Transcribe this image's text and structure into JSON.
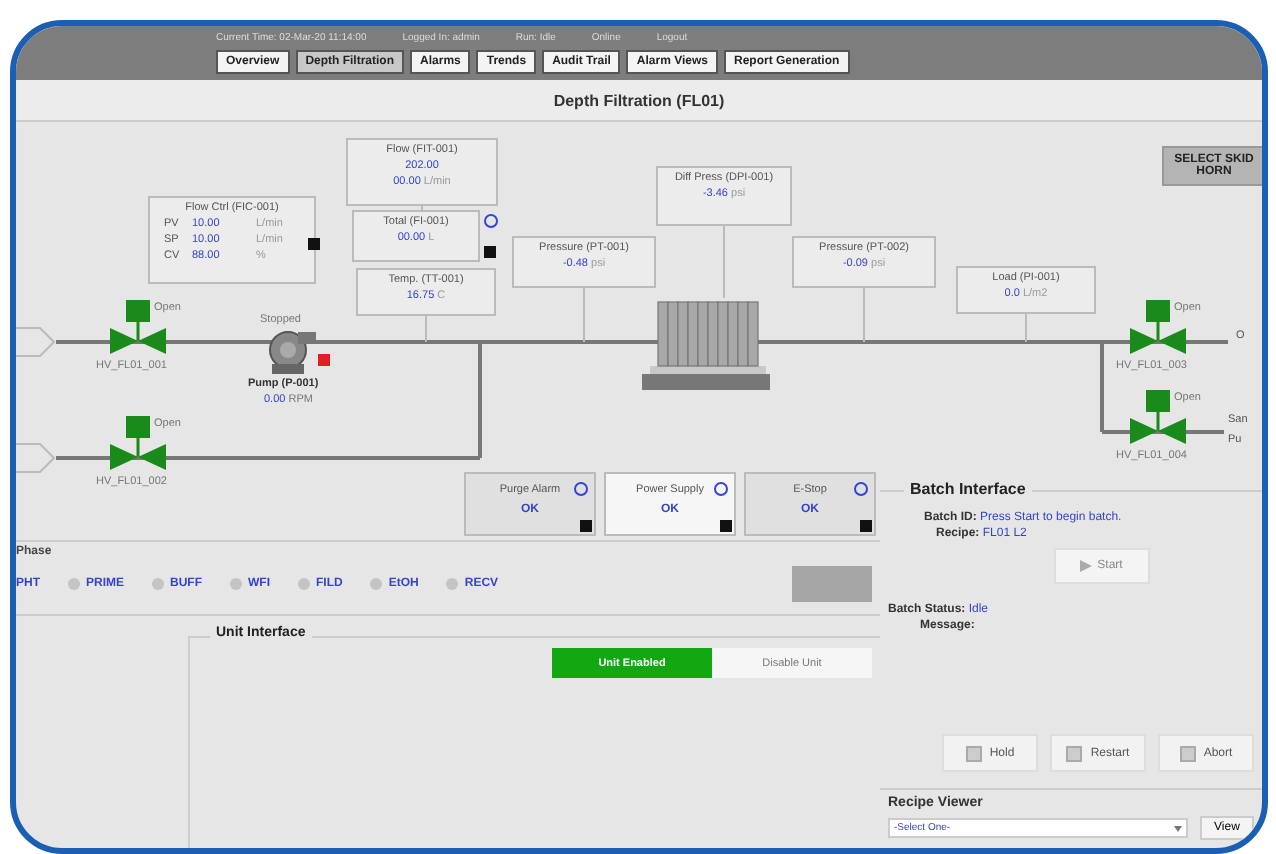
{
  "header": {
    "info": [
      "Current Time: 02-Mar-20 11:14:00",
      "Logged In: admin",
      "Run: Idle",
      "Online",
      "Logout"
    ],
    "nav": [
      {
        "label": "Overview",
        "selected": false
      },
      {
        "label": "Depth Filtration",
        "selected": true
      },
      {
        "label": "Alarms",
        "selected": false
      },
      {
        "label": "Trends",
        "selected": false
      },
      {
        "label": "Audit Trail",
        "selected": false
      },
      {
        "label": "Alarm Views",
        "selected": false
      },
      {
        "label": "Report Generation",
        "selected": false
      }
    ]
  },
  "title": "Depth Filtration (FL01)",
  "horn_button": "SELECT SKID HORN",
  "instruments": [
    {
      "kind": "table",
      "title": "Flow Ctrl (FIC-001)",
      "rows": [
        {
          "tag": "PV",
          "value": "10.00",
          "unit": "L/min"
        },
        {
          "tag": "SP",
          "value": "10.00",
          "unit": "L/min"
        },
        {
          "tag": "CV",
          "value": "88.00",
          "unit": "%"
        }
      ]
    },
    {
      "kind": "readout",
      "title": "Flow (FIT-001)",
      "lines": [
        {
          "value": "202.00"
        },
        {
          "value": "00.00",
          "unit": "L/min"
        }
      ]
    },
    {
      "kind": "readout",
      "title": "Total (FI-001)",
      "lines": [
        {
          "value": "00.00",
          "unit": "L"
        }
      ]
    },
    {
      "kind": "readout",
      "title": "Temp. (TT-001)",
      "lines": [
        {
          "value": "16.75",
          "unit": "C"
        }
      ]
    },
    {
      "kind": "readout",
      "title": "Pressure (PT-001)",
      "lines": [
        {
          "value": "-0.48",
          "unit": "psi"
        }
      ]
    },
    {
      "kind": "readout",
      "title": "Diff Press (DPI-001)",
      "lines": [
        {
          "value": "-3.46",
          "unit": "psi"
        }
      ]
    },
    {
      "kind": "readout",
      "title": "Pressure (PT-002)",
      "lines": [
        {
          "value": "-0.09",
          "unit": "psi"
        }
      ]
    },
    {
      "kind": "readout",
      "title": "Load (PI-001)",
      "lines": [
        {
          "value": "0.0",
          "unit": "L/m2"
        }
      ]
    }
  ],
  "valves": [
    {
      "tag": "HV_FL01_001",
      "status": "Open",
      "open": true
    },
    {
      "tag": "HV_FL01_002",
      "status": "Open",
      "open": true
    },
    {
      "tag": "HV_FL01_003",
      "status": "Open",
      "open": true
    },
    {
      "tag": "HV_FL01_004",
      "status": "Open",
      "open": true
    }
  ],
  "pump": {
    "status": "Stopped",
    "name": "Pump (P-001)",
    "value": "0.00",
    "unit": "RPM",
    "fault": true
  },
  "outlets": [
    "O",
    "San",
    "Pu"
  ],
  "status_boxes": [
    {
      "label": "Purge Alarm",
      "value": "OK",
      "highlighted": false
    },
    {
      "label": "Power Supply",
      "value": "OK",
      "highlighted": true
    },
    {
      "label": "E-Stop",
      "value": "OK",
      "highlighted": false
    }
  ],
  "phase": {
    "label": "Phase",
    "items": [
      "PHT",
      "PRIME",
      "BUFF",
      "WFI",
      "FILD",
      "EtOH",
      "RECV"
    ]
  },
  "unit_interface": {
    "title": "Unit Interface",
    "buttons": [
      {
        "label": "Unit Enabled",
        "selected": true
      },
      {
        "label": "Disable Unit",
        "selected": false
      }
    ]
  },
  "batch": {
    "title": "Batch Interface",
    "fields": [
      {
        "label": "Batch ID:",
        "value": "Press Start to begin batch."
      },
      {
        "label": "Recipe:",
        "value": "FL01 L2"
      }
    ],
    "start": "Start",
    "status_label": "Batch Status:",
    "status": "Idle",
    "message_label": "Message:",
    "buttons": [
      "Hold",
      "Restart",
      "Abort"
    ]
  },
  "recipe_viewer": {
    "title": "Recipe Viewer",
    "select": "-Select One-",
    "button": "View"
  }
}
